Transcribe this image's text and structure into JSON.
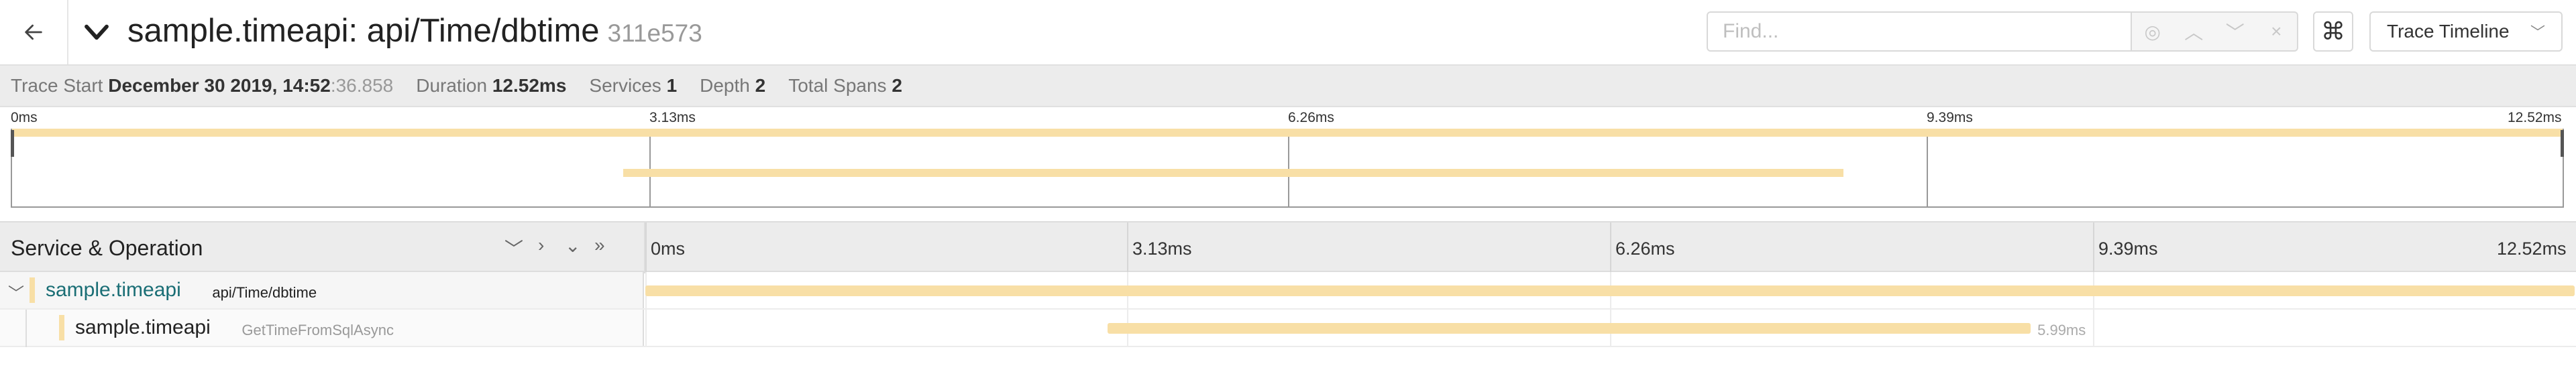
{
  "header": {
    "title": "sample.timeapi: api/Time/dbtime",
    "trace_id": "311e573",
    "find_placeholder": "Find...",
    "keyboard_icon_glyph": "⌘",
    "view_select": "Trace Timeline"
  },
  "summary": {
    "trace_start_label": "Trace Start",
    "trace_start_value": "December 30 2019, 14:52",
    "trace_start_seconds": ":36.858",
    "duration_label": "Duration",
    "duration_value": "12.52ms",
    "services_label": "Services",
    "services_value": "1",
    "depth_label": "Depth",
    "depth_value": "2",
    "total_spans_label": "Total Spans",
    "total_spans_value": "2"
  },
  "minimap": {
    "ticks": [
      "0ms",
      "3.13ms",
      "6.26ms",
      "9.39ms",
      "12.52ms"
    ]
  },
  "timeline": {
    "column_title": "Service & Operation",
    "ticks": [
      "0ms",
      "3.13ms",
      "6.26ms",
      "9.39ms",
      "12.52ms"
    ]
  },
  "spans": [
    {
      "service": "sample.timeapi",
      "operation": "api/Time/dbtime",
      "start_ms": 0,
      "duration_ms": 12.52,
      "duration_label": "",
      "depth": 0,
      "has_children": true,
      "service_color": "#1a6e75",
      "op_color": "#222222"
    },
    {
      "service": "sample.timeapi",
      "operation": "GetTimeFromSqlAsync",
      "start_ms": 3.0,
      "duration_ms": 5.99,
      "duration_label": "5.99ms",
      "depth": 1,
      "has_children": false,
      "service_color": "#222222",
      "op_color": "#999999"
    }
  ],
  "colors": {
    "span_bar": "#f8dfa6",
    "service_teal": "#1a6e75"
  },
  "icons": {
    "back": "arrow-left-icon",
    "collapse": "chevron-down-icon",
    "find_target": "target-icon",
    "find_prev": "chevron-up-icon",
    "find_next": "chevron-down-icon",
    "find_clear": "close-icon",
    "keyboard": "command-icon",
    "select_caret": "chevron-down-icon"
  }
}
